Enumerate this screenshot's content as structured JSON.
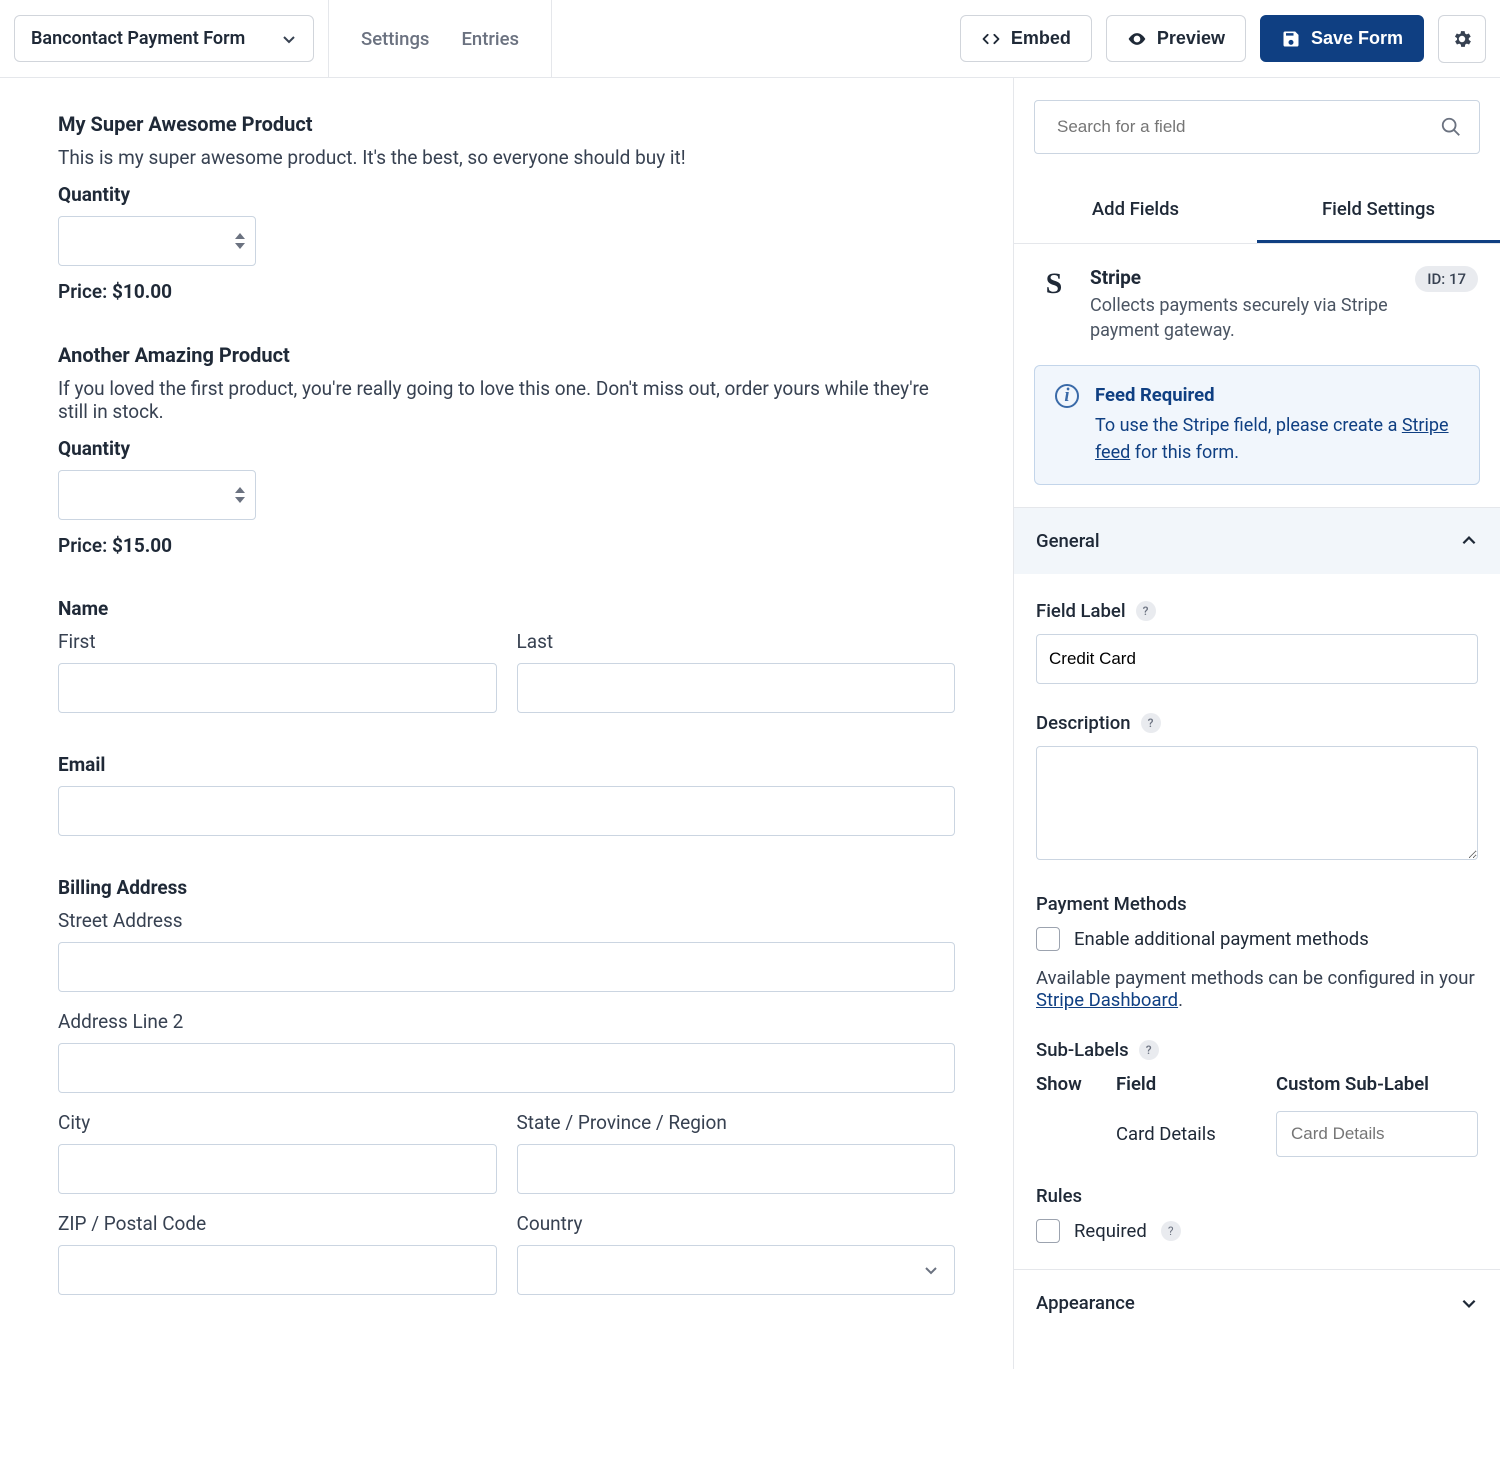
{
  "topbar": {
    "form_name": "Bancontact Payment Form",
    "nav": {
      "settings": "Settings",
      "entries": "Entries"
    },
    "embed": "Embed",
    "preview": "Preview",
    "save": "Save Form"
  },
  "canvas": {
    "product1": {
      "title": "My Super Awesome Product",
      "desc": "This is my super awesome product. It's the best, so everyone should buy it!",
      "qty_label": "Quantity",
      "price_label": "Price:",
      "price_value": "$10.00"
    },
    "product2": {
      "title": "Another Amazing Product",
      "desc": "If you loved the first product, you're really going to love this one. Don't miss out, order yours while they're still in stock.",
      "qty_label": "Quantity",
      "price_label": "Price:",
      "price_value": "$15.00"
    },
    "name": {
      "label": "Name",
      "first": "First",
      "last": "Last"
    },
    "email": {
      "label": "Email"
    },
    "billing": {
      "label": "Billing Address",
      "street": "Street Address",
      "line2": "Address Line 2",
      "city": "City",
      "state": "State / Province / Region",
      "zip": "ZIP / Postal Code",
      "country": "Country"
    }
  },
  "sidebar": {
    "search_placeholder": "Search for a field",
    "tabs": {
      "add": "Add Fields",
      "settings": "Field Settings"
    },
    "field": {
      "name": "Stripe",
      "desc": "Collects payments securely via Stripe payment gateway.",
      "id_label": "ID: 17"
    },
    "notice": {
      "title": "Feed Required",
      "before": "To use the Stripe field, please create a ",
      "link": "Stripe feed",
      "after": " for this form."
    },
    "general": {
      "title": "General",
      "field_label": "Field Label",
      "field_label_value": "Credit Card",
      "description": "Description",
      "payment_methods": "Payment Methods",
      "enable_additional": "Enable additional payment methods",
      "available_before": "Available payment methods can be configured in your ",
      "available_link": "Stripe Dashboard",
      "available_after": ".",
      "sub_labels": "Sub-Labels",
      "col_show": "Show",
      "col_field": "Field",
      "col_custom": "Custom Sub-Label",
      "card_details": "Card Details",
      "card_details_placeholder": "Card Details",
      "rules": "Rules",
      "required": "Required"
    },
    "appearance": {
      "title": "Appearance"
    }
  }
}
